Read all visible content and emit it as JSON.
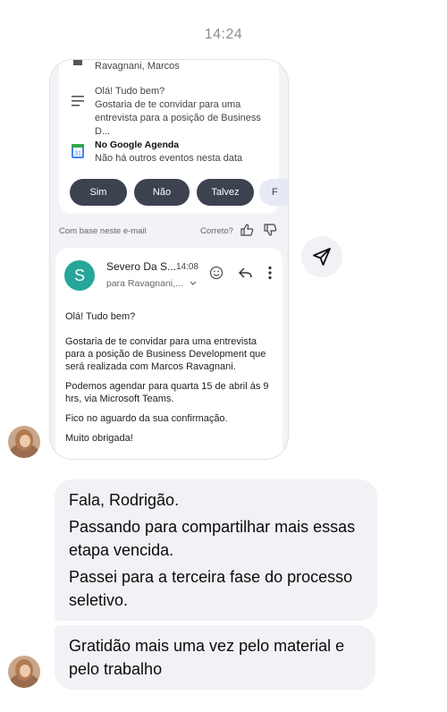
{
  "time": "14:24",
  "card": {
    "top_partial_text": "Ravagnani, Marcos",
    "message_row": {
      "icon": "notes-icon",
      "line1": "Olá! Tudo bem?",
      "line2": "Gostaria de te convidar para uma",
      "line3": "entrevista para a posição de Business D..."
    },
    "calendar_row": {
      "icon": "google-calendar-icon",
      "title": "No Google Agenda",
      "subtitle": "Não há outros eventos nesta data"
    },
    "rsvp_buttons": [
      "Sim",
      "Não",
      "Talvez",
      "F"
    ],
    "based_on_text": "Com base neste e-mail",
    "correct_text": "Correto?",
    "email": {
      "avatar_letter": "S",
      "sender": "Severo Da S...",
      "time": "14:08",
      "recipient": "para Ravagnani,...",
      "greeting": "Olá! Tudo bem?",
      "p1": "Gostaria de te convidar para uma entrevista para a posição de Business Development que será realizada com Marcos Ravagnani.",
      "p2": "Podemos agendar para quarta 15 de abril ás 9 hrs, via Microsoft Teams.",
      "p3": "Fico no aguardo da sua confirmação.",
      "p4": "Muito obrigada!"
    }
  },
  "messages": [
    {
      "lines": [
        "Fala, Rodrigão.",
        "Passando para compartilhar mais essas etapa vencida.",
        "Passei para a terceira fase do processo seletivo."
      ]
    },
    {
      "lines": [
        "Gratidão mais uma vez pelo material e pelo trabalho"
      ]
    }
  ],
  "colors": {
    "bubble_bg": "#f0f2f5",
    "button_bg": "#3c4250",
    "avatar_green": "#26a69a"
  }
}
